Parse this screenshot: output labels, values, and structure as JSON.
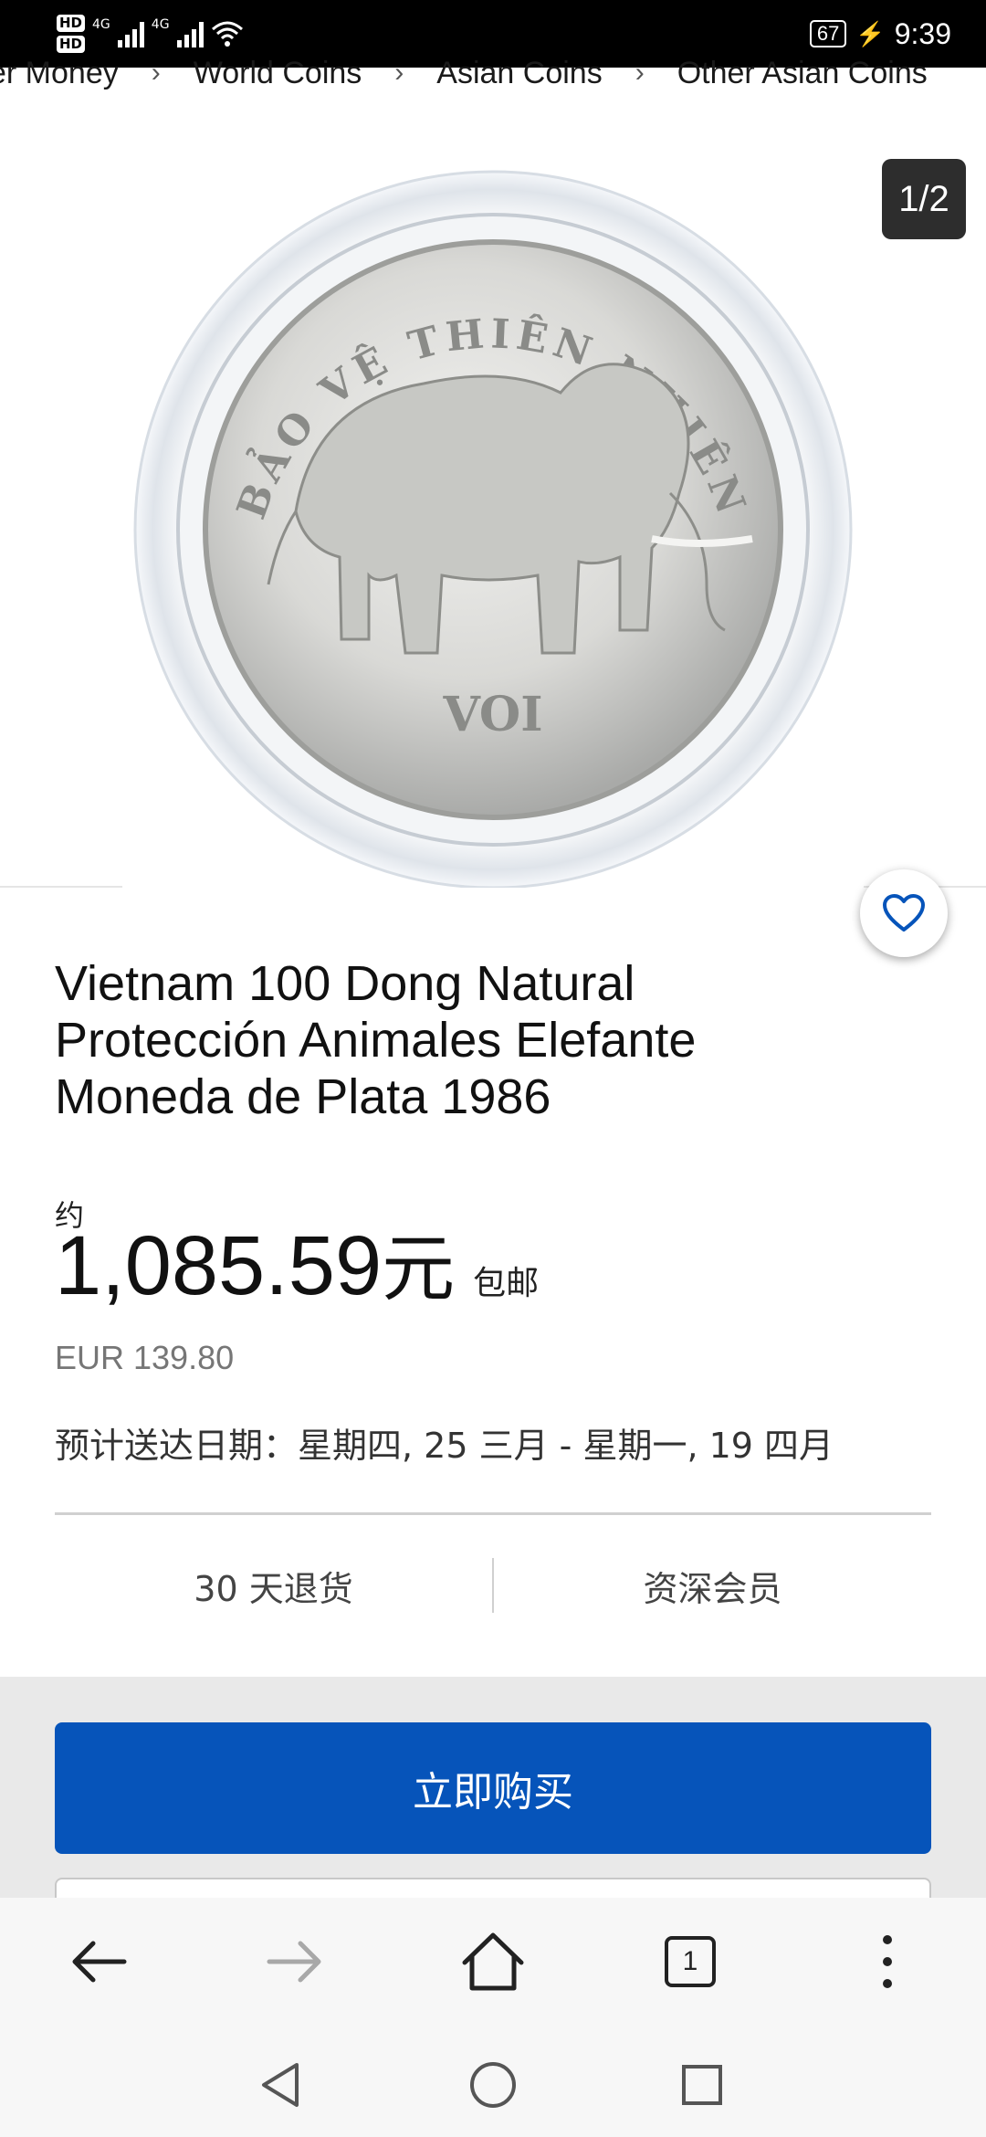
{
  "status_bar": {
    "hd1": "HD",
    "hd2": "HD",
    "network1": "4G",
    "network2": "4G",
    "battery": "67",
    "time": "9:39"
  },
  "breadcrumb": [
    "er Money",
    "World Coins",
    "Asian Coins",
    "Other Asian Coins"
  ],
  "gallery": {
    "counter": "1/2",
    "coin_top_text": "BẢO VỆ THIÊN NHIÊN",
    "coin_bottom_text": "VOI"
  },
  "listing": {
    "title": "Vietnam 100 Dong Natural Protección Animales Elefante Moneda de Plata 1986",
    "approx_label": "约",
    "price": "1,085.59",
    "price_unit": "元",
    "shipping": "包邮",
    "original_price": "EUR 139.80",
    "delivery": "预计送达日期：星期四, 25 三月 - 星期一, 19 四月",
    "features": [
      "30 天退货",
      "资深会员"
    ]
  },
  "actions": {
    "buy_now": "立即购买"
  },
  "browser": {
    "tab_count": "1"
  },
  "icons": {
    "favorite": "heart-outline-icon",
    "back": "arrow-left-icon",
    "forward": "arrow-right-icon",
    "home": "home-icon",
    "menu": "more-vertical-icon"
  },
  "colors": {
    "buy_button": "#0654ba",
    "heart": "#0654ba",
    "status_bar": "#000000",
    "buy_area_bg": "#e9e9e9"
  }
}
